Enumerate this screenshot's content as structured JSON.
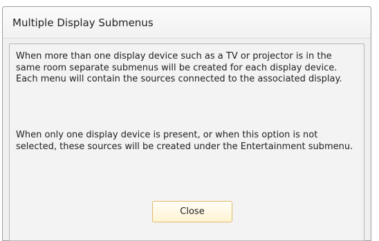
{
  "dialog": {
    "title": "Multiple Display Submenus",
    "paragraphs": [
      "When more than one display device such as a TV or projector is in the same room separate submenus will be created for each display device. Each menu will contain the sources connected to the associated display.",
      "When only one display device is present, or when this option is not selected, these sources will be created under the Entertainment submenu."
    ],
    "close_label": "Close"
  }
}
